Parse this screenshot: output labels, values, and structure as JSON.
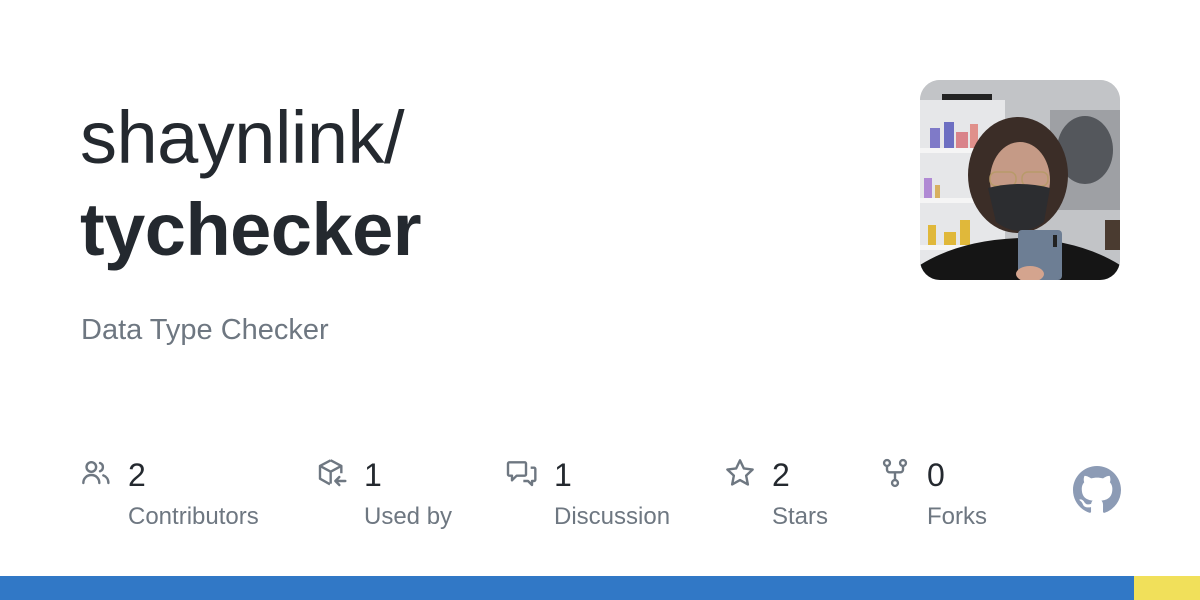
{
  "repo": {
    "owner": "shaynlink/",
    "name": "tychecker",
    "description": "Data Type Checker"
  },
  "stats": [
    {
      "icon": "people-icon",
      "value": "2",
      "label": "Contributors"
    },
    {
      "icon": "package-dependents-icon",
      "value": "1",
      "label": "Used by"
    },
    {
      "icon": "discussion-icon",
      "value": "1",
      "label": "Discussion"
    },
    {
      "icon": "star-icon",
      "value": "2",
      "label": "Stars"
    },
    {
      "icon": "fork-icon",
      "value": "0",
      "label": "Forks"
    }
  ],
  "languages": [
    {
      "color": "#3178c6",
      "percent": 94.5
    },
    {
      "color": "#f1e05a",
      "percent": 5.5
    }
  ],
  "colors": {
    "text_primary": "#24292f",
    "text_secondary": "#6e7781",
    "icon": "#6e7781",
    "github_logo": "#8c9bb5"
  }
}
